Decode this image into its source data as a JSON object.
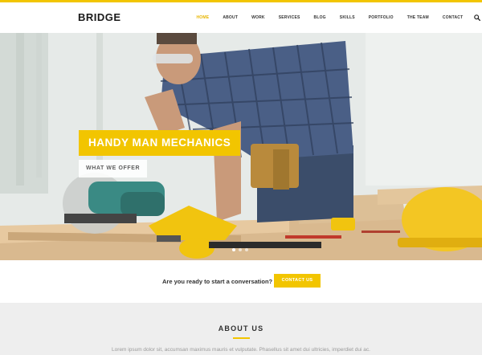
{
  "brand": {
    "logo_text": "BRIDGE",
    "accent_color": "#f2c500"
  },
  "nav": {
    "items": [
      {
        "label": "HOME",
        "active": true
      },
      {
        "label": "ABOUT",
        "active": false
      },
      {
        "label": "WORK",
        "active": false
      },
      {
        "label": "SERVICES",
        "active": false
      },
      {
        "label": "BLOG",
        "active": false
      },
      {
        "label": "SKILLS",
        "active": false
      },
      {
        "label": "PORTFOLIO",
        "active": false
      },
      {
        "label": "THE TEAM",
        "active": false
      },
      {
        "label": "CONTACT",
        "active": false
      }
    ],
    "search_icon": "search-icon"
  },
  "hero": {
    "title": "HANDY MAN MECHANICS",
    "subtitle": "WHAT WE OFFER",
    "slide_count": 3,
    "active_slide": 1
  },
  "cta": {
    "text": "Are you ready to start a conversation?",
    "button_label": "CONTACT US"
  },
  "about": {
    "title": "ABOUT US",
    "text": "Lorem ipsum dolor sit, accumsan maximus mauris et vulputate. Phasellus sit amet dui ultricies, imperdiet dui ac."
  }
}
